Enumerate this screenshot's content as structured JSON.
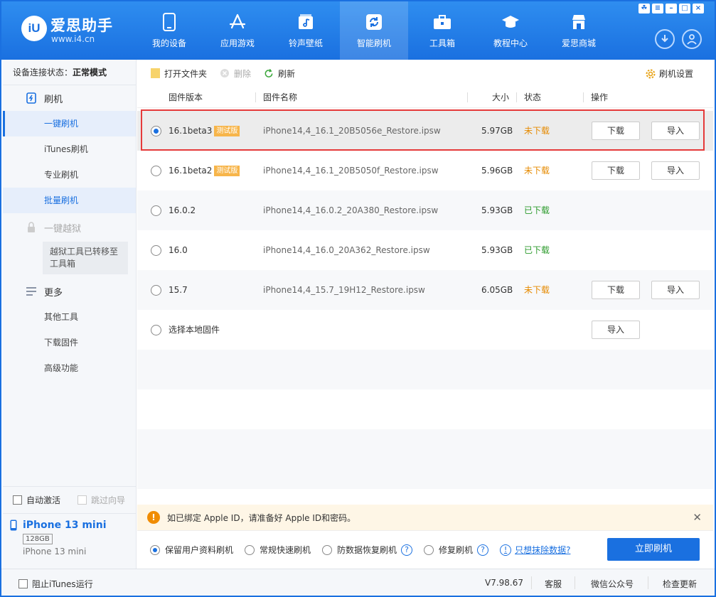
{
  "app": {
    "brand": "爱思助手",
    "url": "www.i4.cn",
    "logo_text": "iU"
  },
  "nav": [
    {
      "label": "我的设备",
      "icon": "phone-icon"
    },
    {
      "label": "应用游戏",
      "icon": "app-store-icon"
    },
    {
      "label": "铃声壁纸",
      "icon": "music-icon"
    },
    {
      "label": "智能刷机",
      "icon": "refresh-icon",
      "active": true
    },
    {
      "label": "工具箱",
      "icon": "toolbox-icon"
    },
    {
      "label": "教程中心",
      "icon": "graduation-cap-icon"
    },
    {
      "label": "爱思商城",
      "icon": "shop-icon"
    }
  ],
  "sidebar": {
    "status_label": "设备连接状态：",
    "status_value": "正常模式",
    "flash_title": "刷机",
    "flash_items": [
      "一键刷机",
      "iTunes刷机",
      "专业刷机",
      "批量刷机"
    ],
    "jailbreak_title": "一键越狱",
    "jailbreak_notice": "越狱工具已转移至工具箱",
    "more_title": "更多",
    "more_items": [
      "其他工具",
      "下载固件",
      "高级功能"
    ],
    "auto_activate": "自动激活",
    "skip_guide": "跳过向导",
    "device_name": "iPhone 13 mini",
    "device_capacity": "128GB",
    "device_model": "iPhone 13 mini"
  },
  "toolbar": {
    "open_folder": "打开文件夹",
    "delete": "删除",
    "refresh": "刷新",
    "settings": "刷机设置"
  },
  "table": {
    "headers": {
      "version": "固件版本",
      "name": "固件名称",
      "size": "大小",
      "status": "状态",
      "action": "操作"
    },
    "rows": [
      {
        "version": "16.1beta3",
        "badge": "测试版",
        "name": "iPhone14,4_16.1_20B5056e_Restore.ipsw",
        "size": "5.97GB",
        "status": "未下载",
        "downloaded": false,
        "selected": true
      },
      {
        "version": "16.1beta2",
        "badge": "测试版",
        "name": "iPhone14,4_16.1_20B5050f_Restore.ipsw",
        "size": "5.96GB",
        "status": "未下载",
        "downloaded": false
      },
      {
        "version": "16.0.2",
        "badge": "",
        "name": "iPhone14,4_16.0.2_20A380_Restore.ipsw",
        "size": "5.93GB",
        "status": "已下载",
        "downloaded": true
      },
      {
        "version": "16.0",
        "badge": "",
        "name": "iPhone14,4_16.0_20A362_Restore.ipsw",
        "size": "5.93GB",
        "status": "已下载",
        "downloaded": true
      },
      {
        "version": "15.7",
        "badge": "",
        "name": "iPhone14,4_15.7_19H12_Restore.ipsw",
        "size": "6.05GB",
        "status": "未下载",
        "downloaded": false
      }
    ],
    "local_label": "选择本地固件",
    "download_btn": "下载",
    "import_btn": "导入"
  },
  "warning": {
    "text": "如已绑定 Apple ID，请准备好 Apple ID和密码。",
    "icon": "!"
  },
  "flash_options": {
    "keep_data": "保留用户资料刷机",
    "quick": "常规快速刷机",
    "anti_recovery": "防数据恢复刷机",
    "repair": "修复刷机",
    "erase_link": "只想抹除数据?",
    "flash_now": "立即刷机"
  },
  "footer": {
    "block_itunes": "阻止iTunes运行",
    "version": "V7.98.67",
    "support": "客服",
    "wechat": "微信公众号",
    "check_update": "检查更新"
  },
  "colors": {
    "primary": "#1a70e0",
    "not_downloaded": "#e68a00",
    "downloaded": "#2d9b2d",
    "highlight_frame": "#e53a3a"
  }
}
